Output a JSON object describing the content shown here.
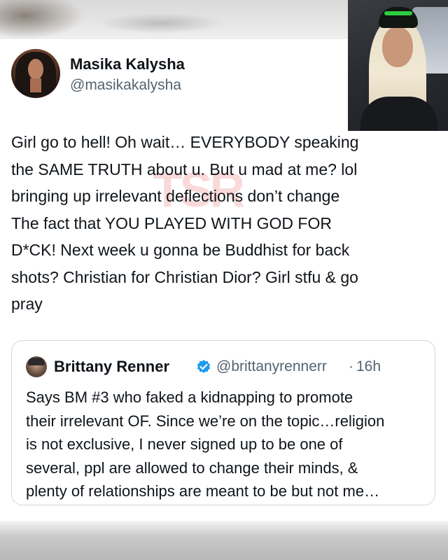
{
  "post": {
    "author_name": "Masika Kalysha",
    "author_handle": "@masikakalysha",
    "text_lines": [
      "Girl go to hell! Oh wait… EVERYBODY speaking",
      "the SAME TRUTH about u. But u mad at me? lol",
      "bringing up irrelevant deflections don’t change",
      "The fact that YOU PLAYED WITH GOD FOR",
      "D*CK! Next week u gonna be Buddhist for back",
      "shots? Christian for Christian Dior? Girl stfu & go",
      "pray"
    ],
    "watermark": "TSR"
  },
  "quoted_post": {
    "author_name": "Brittany Renner",
    "verified": true,
    "author_handle": "@brittanyrennerr",
    "separator": "·",
    "time": "16h",
    "text_lines": [
      "Says BM #3 who faked a kidnapping to promote",
      "their irrelevant OF. Since we’re on the topic…religion",
      "is not exclusive, I never signed up to be one of",
      "several, ppl are allowed to change their minds, &",
      "plenty of relationships are meant to be but not me…"
    ]
  },
  "icons": {
    "author_avatar": "avatar-photo",
    "quoted_avatar": "avatar-photo",
    "verified_badge": "verified-check-icon",
    "video_inset": "video-overlay-photo"
  },
  "colors": {
    "text_primary": "#0f1419",
    "text_secondary": "#536471",
    "verified_blue": "#1d9bf0",
    "border": "#cfd9de"
  }
}
